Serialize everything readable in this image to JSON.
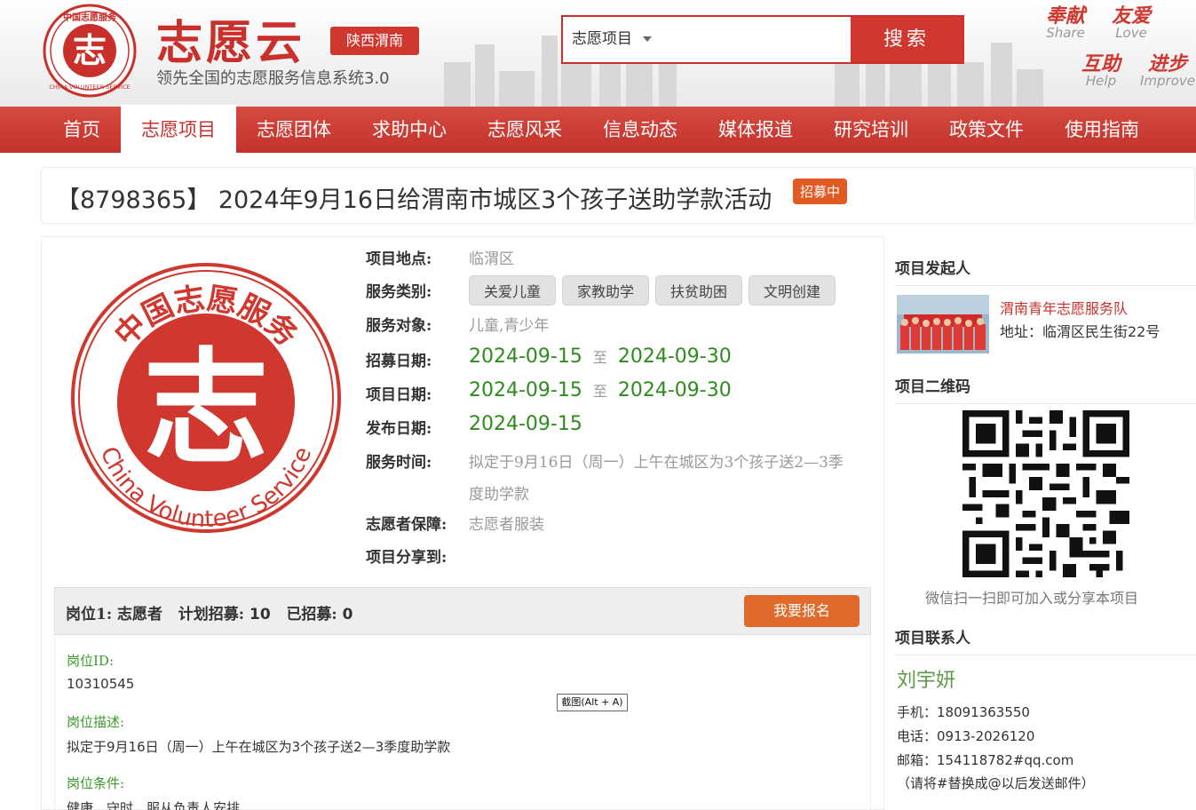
{
  "header": {
    "brand_title": "志愿云",
    "brand_subtitle": "领先全国的志愿服务信息系统3.0",
    "logo_ring_text": "中国志愿服务",
    "logo_ring_text_en": "CHINA VOLUNTEER SERVICE",
    "logo_char": "志",
    "region": "陕西渭南",
    "search_select": "志愿项目",
    "search_button": "搜索",
    "slogans": [
      {
        "cn": "奉献",
        "en": "Share"
      },
      {
        "cn": "友爱",
        "en": "Love"
      },
      {
        "cn": "互助",
        "en": "Help"
      },
      {
        "cn": "进步",
        "en": "Improve"
      }
    ]
  },
  "nav": {
    "items": [
      "首页",
      "志愿项目",
      "志愿团体",
      "求助中心",
      "志愿风采",
      "信息动态",
      "媒体报道",
      "研究培训",
      "政策文件",
      "使用指南"
    ],
    "active_index": 1
  },
  "project": {
    "title": "【8798365】 2024年9月16日给渭南市城区3个孩子送助学款活动",
    "status": "招募中",
    "logo_top_text": "中国志愿服务",
    "logo_bottom_text": "China Volunteer Service",
    "logo_char": "志",
    "labels": {
      "location": "项目地点:",
      "category": "服务类别:",
      "target": "服务对象:",
      "recruit": "招募日期:",
      "period": "项目日期:",
      "publish": "发布日期:",
      "service_time": "服务时间:",
      "guarantee": "志愿者保障:",
      "share": "项目分享到:"
    },
    "location": "临渭区",
    "categories": [
      "关爱儿童",
      "家教助学",
      "扶贫助困",
      "文明创建"
    ],
    "target": "儿童,青少年",
    "recruit_start": "2024-09-15",
    "recruit_end": "2024-09-30",
    "period_start": "2024-09-15",
    "period_end": "2024-09-30",
    "date_sep": "至",
    "publish_date": "2024-09-15",
    "service_time_line1": "拟定于9月16日（周一）上午在城区为3个孩子送2—3季",
    "service_time_line2": "度助学款",
    "guarantee": "志愿者服装"
  },
  "position": {
    "label": "岗位1:",
    "role": "志愿者",
    "plan_label": "计划招募:",
    "plan": "10",
    "recruited_label": "已招募:",
    "recruited": "0",
    "signup_button": "我要报名",
    "id_label": "岗位ID:",
    "id": "10310545",
    "desc_label": "岗位描述:",
    "desc": "拟定于9月16日（周一）上午在城区为3个孩子送2—3季度助学款",
    "cond_label": "岗位条件:",
    "cond": "健康、守时、服从负责人安排"
  },
  "tooltip": "截图(Alt + A)",
  "sidebar": {
    "initiator_head": "项目发起人",
    "team_name": "渭南青年志愿服务队",
    "team_address": "地址：临渭区民生街22号",
    "qr_head": "项目二维码",
    "qr_caption": "微信扫一扫即可加入或分享本项目",
    "contact_head": "项目联系人",
    "contact_name": "刘宇妍",
    "mobile": "手机：18091363550",
    "phone": "电话：0913-2026120",
    "email": "邮箱：154118782#qq.com",
    "email_note": "（请将#替换成@以后发送邮件）"
  },
  "colors": {
    "brand_red": "#c9302c",
    "nav_red": "#d0372f",
    "date_green": "#2e8b1e",
    "signup_orange": "#e06a2a"
  }
}
